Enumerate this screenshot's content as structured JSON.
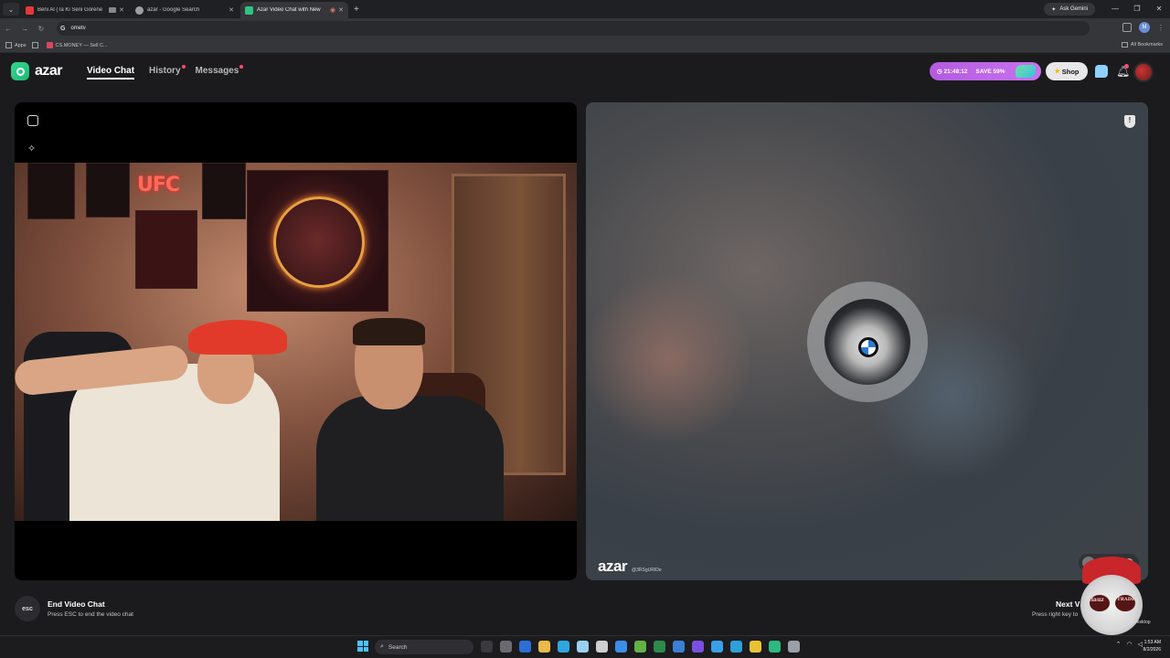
{
  "browser": {
    "tabs": [
      {
        "title": "Beni Al (Ta Ki Seni Görene",
        "favicon_color": "#e53935",
        "active": false
      },
      {
        "title": "azar - Google Search",
        "favicon_color": "#9e9e9e",
        "active": false
      },
      {
        "title": "Azar Video Chat with New",
        "favicon_color": "#2fc57f",
        "active": true
      }
    ],
    "ask_gemini_label": "Ask Gemini",
    "omnibox_value": "ometv",
    "bookmarks": [
      {
        "label": "Apps"
      },
      {
        "label": "CS.MONEY — Sell C..."
      }
    ],
    "all_bookmarks_label": "All Bookmarks",
    "profile_initial": "M"
  },
  "app": {
    "logo_text": "azar",
    "nav": [
      {
        "label": "Video Chat",
        "active": true,
        "dot": false
      },
      {
        "label": "History",
        "active": false,
        "dot": true
      },
      {
        "label": "Messages",
        "active": false,
        "dot": true
      }
    ],
    "promo": {
      "timer": "21:48:12",
      "discount": "SAVE 59%"
    },
    "shop_label": "Shop"
  },
  "video": {
    "left_neon_sign": "UFC",
    "watermark_logo": "azar",
    "watermark_id": "@3RSgURIDe",
    "partner_name": "sara"
  },
  "hints": {
    "esc_key": "esc",
    "end_title": "End Video Chat",
    "end_sub": "Press ESC to end the video chat",
    "next_title": "Next V",
    "next_sub": "Press right key to",
    "streamer_left": "Clauz",
    "streamer_right": "TRADE",
    "desktop_tip": "w desktop"
  },
  "taskbar": {
    "search_placeholder": "Search",
    "time": "1:53 AM",
    "date": "8/2/2026",
    "app_colors": [
      "#3a3a3e",
      "#6a6a70",
      "#2b6fd6",
      "#e9b949",
      "#2ea6e0",
      "#9ad1f0",
      "#cfcfcf",
      "#3a8ee6",
      "#62b246",
      "#2b8a4a",
      "#3c7fd6",
      "#7b4fe0",
      "#3aa0e6",
      "#2ea0d8",
      "#e9c233",
      "#2fb87f",
      "#9aa0a6"
    ]
  }
}
